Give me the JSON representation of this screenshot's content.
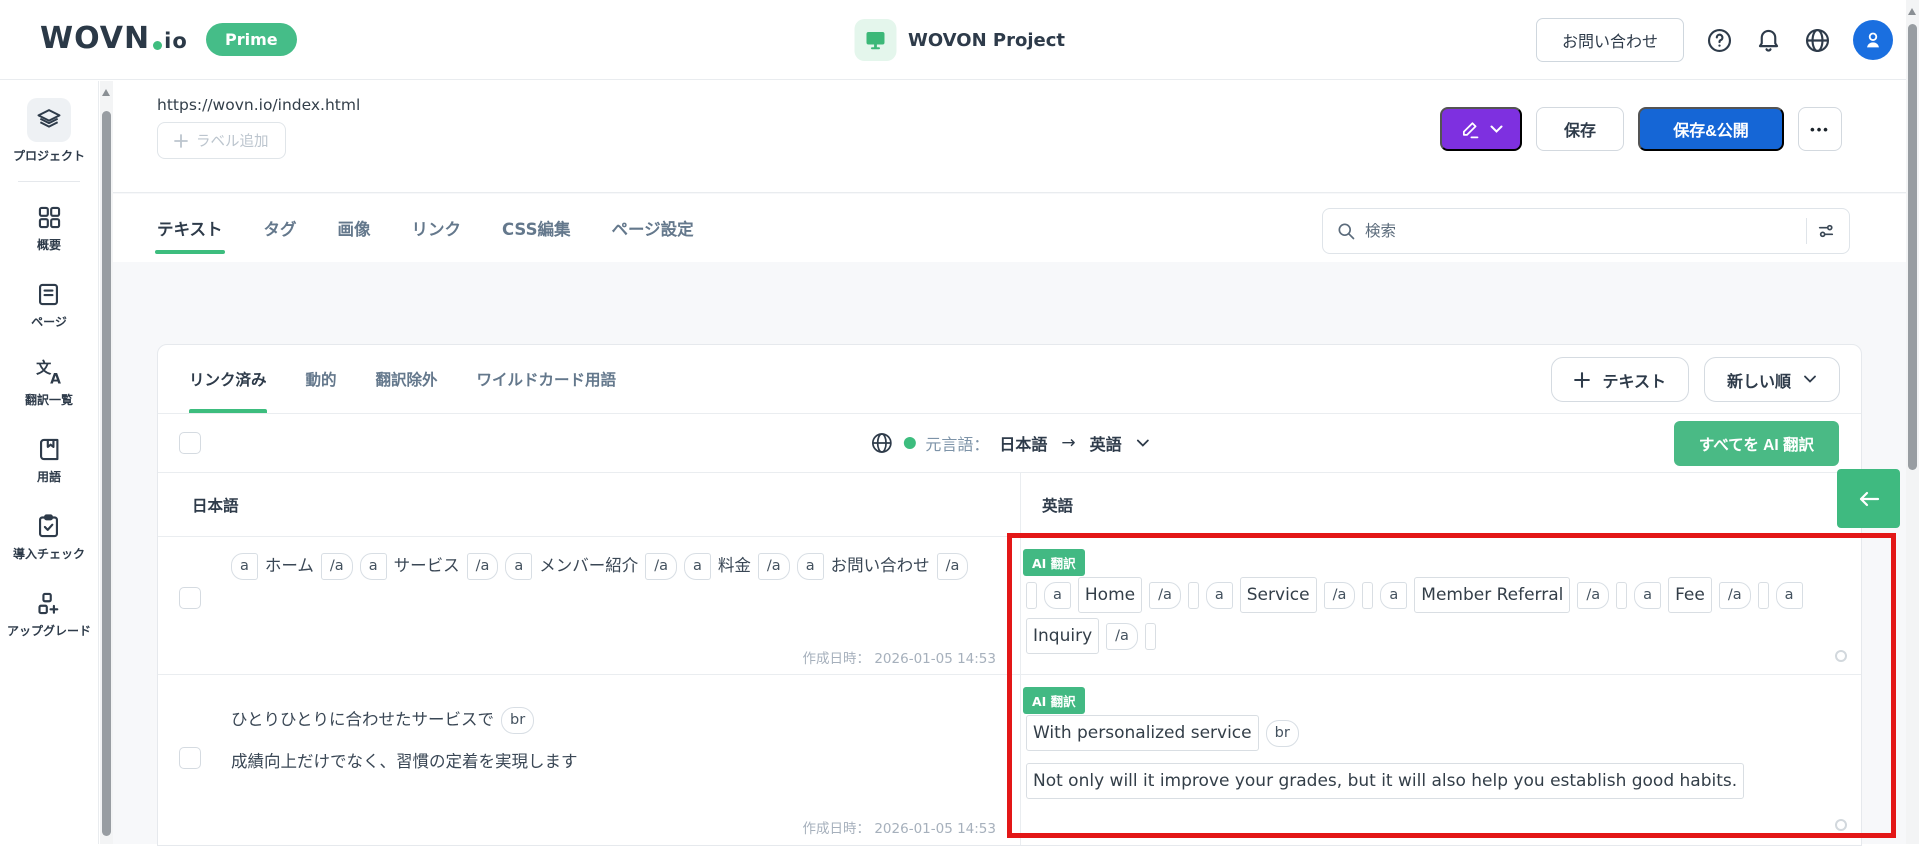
{
  "header": {
    "logo_main": "WOVN",
    "logo_suffix": "io",
    "prime_badge": "Prime",
    "project_name": "WOVON Project",
    "contact_button": "お問い合わせ"
  },
  "sidebar": {
    "items": [
      {
        "label": "プロジェクト",
        "icon": "layers-icon"
      },
      {
        "label": "概要",
        "icon": "grid-icon"
      },
      {
        "label": "ページ",
        "icon": "page-icon"
      },
      {
        "label": "翻訳一覧",
        "icon": "translate-icon"
      },
      {
        "label": "用語",
        "icon": "book-icon"
      },
      {
        "label": "導入チェック",
        "icon": "clipboard-check-icon"
      },
      {
        "label": "アップグレード",
        "icon": "upgrade-icon"
      }
    ]
  },
  "toolbar": {
    "page_url": "https://wovn.io/index.html",
    "add_label_button": "ラベル追加",
    "save_button": "保存",
    "save_publish_button": "保存&公開",
    "more_button": "•••"
  },
  "tabs": {
    "items": [
      "テキスト",
      "タグ",
      "画像",
      "リンク",
      "CSS編集",
      "ページ設定"
    ],
    "active": "テキスト",
    "search_placeholder": "検索"
  },
  "panel": {
    "subtabs": [
      "リンク済み",
      "動的",
      "翻訳除外",
      "ワイルドカード用語"
    ],
    "active_subtab": "リンク済み",
    "add_text_button": "テキスト",
    "sort_button": "新しい順",
    "source_label": "元言語：",
    "source_lang": "日本語",
    "arrow": "→",
    "target_lang": "英語",
    "translate_all_button": "すべてを AI 翻訳",
    "columns": {
      "source": "日本語",
      "target": "英語"
    }
  },
  "rows": [
    {
      "created_at": "作成日時： 2026-01-05 14:53",
      "ai_badge": "AI 翻訳",
      "source_segments": [
        {
          "t": "tag",
          "shape": "open",
          "v": "a"
        },
        {
          "t": "text",
          "v": "ホーム"
        },
        {
          "t": "tag",
          "shape": "close",
          "v": "/a"
        },
        {
          "t": "tag",
          "shape": "open",
          "v": "a"
        },
        {
          "t": "text",
          "v": "サービス"
        },
        {
          "t": "tag",
          "shape": "close",
          "v": "/a"
        },
        {
          "t": "tag",
          "shape": "open",
          "v": "a"
        },
        {
          "t": "text",
          "v": "メンバー紹介"
        },
        {
          "t": "tag",
          "shape": "close",
          "v": "/a"
        },
        {
          "t": "tag",
          "shape": "open",
          "v": "a"
        },
        {
          "t": "text",
          "v": "料金"
        },
        {
          "t": "tag",
          "shape": "close",
          "v": "/a"
        },
        {
          "t": "tag",
          "shape": "open",
          "v": "a"
        },
        {
          "t": "text",
          "v": "お問い合わせ"
        },
        {
          "t": "tag",
          "shape": "close",
          "v": "/a"
        }
      ],
      "target_segments": [
        {
          "t": "empty"
        },
        {
          "t": "tag",
          "shape": "open",
          "v": "a"
        },
        {
          "t": "box",
          "v": "Home"
        },
        {
          "t": "tag",
          "shape": "close",
          "v": "/a"
        },
        {
          "t": "empty"
        },
        {
          "t": "tag",
          "shape": "open",
          "v": "a"
        },
        {
          "t": "box",
          "v": "Service"
        },
        {
          "t": "tag",
          "shape": "close",
          "v": "/a"
        },
        {
          "t": "empty"
        },
        {
          "t": "tag",
          "shape": "open",
          "v": "a"
        },
        {
          "t": "box",
          "v": "Member Referral"
        },
        {
          "t": "tag",
          "shape": "close",
          "v": "/a"
        },
        {
          "t": "empty"
        },
        {
          "t": "tag",
          "shape": "open",
          "v": "a"
        },
        {
          "t": "box",
          "v": "Fee"
        },
        {
          "t": "tag",
          "shape": "close",
          "v": "/a"
        },
        {
          "t": "empty"
        },
        {
          "t": "tag",
          "shape": "open",
          "v": "a"
        },
        {
          "t": "box",
          "v": "Inquiry"
        },
        {
          "t": "tag",
          "shape": "close",
          "v": "/a"
        },
        {
          "t": "empty"
        }
      ]
    },
    {
      "created_at": "作成日時： 2026-01-05 14:53",
      "ai_badge": "AI 翻訳",
      "source_segments": [
        {
          "t": "text",
          "v": "ひとりひとりに合わせたサービスで"
        },
        {
          "t": "tag",
          "shape": "br",
          "v": "br"
        },
        {
          "t": "break"
        },
        {
          "t": "text",
          "v": "成績向上だけでなく、習慣の定着を実現します"
        }
      ],
      "target_segments": [
        {
          "t": "box",
          "v": "With personalized service"
        },
        {
          "t": "tag",
          "shape": "br",
          "v": "br"
        },
        {
          "t": "break"
        },
        {
          "t": "box",
          "v": "Not only will it improve your grades, but it will also help you establish good habits."
        }
      ]
    }
  ],
  "colors": {
    "accent_green": "#42b983",
    "primary_blue": "#1566d6",
    "edit_purple": "#7e30e0",
    "highlight_red": "#e31717"
  }
}
